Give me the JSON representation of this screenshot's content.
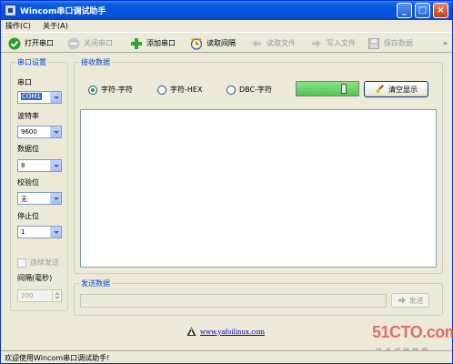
{
  "window": {
    "title": "Wincom串口调试助手",
    "minimize": "_",
    "maximize": "□",
    "close": "×"
  },
  "menu": [
    {
      "label": "操作(C)"
    },
    {
      "label": "关于(A)"
    }
  ],
  "toolbar": [
    {
      "label": "打开串口",
      "enabled": true
    },
    {
      "label": "关闭串口",
      "enabled": false
    },
    {
      "label": "添加串口",
      "enabled": true
    },
    {
      "label": "读取间隔",
      "enabled": true
    },
    {
      "label": "读取文件",
      "enabled": false
    },
    {
      "label": "写入文件",
      "enabled": false
    },
    {
      "label": "保存数据",
      "enabled": false
    }
  ],
  "serial_settings": {
    "title": "串口设置",
    "port": {
      "label": "串口",
      "value": "COM1"
    },
    "baud": {
      "label": "波特率",
      "value": "9600"
    },
    "data_bits": {
      "label": "数据位",
      "value": "8"
    },
    "parity": {
      "label": "校验位",
      "value": "无"
    },
    "stop_bits": {
      "label": "停止位",
      "value": "1"
    },
    "continuous": {
      "label": "连续发送",
      "checked": false
    },
    "interval": {
      "label": "间隔(毫秒)",
      "value": "200"
    }
  },
  "receive": {
    "title": "接收数据",
    "modes": [
      {
        "label": "字符-字符",
        "checked": true
      },
      {
        "label": "字符-HEX",
        "checked": false
      },
      {
        "label": "DBC-字符",
        "checked": false
      }
    ],
    "clear_label": "清空显示",
    "content": ""
  },
  "send": {
    "title": "发送数据",
    "button_label": "发送",
    "content": ""
  },
  "link": {
    "text": "www.yafoilinux.com"
  },
  "watermark": {
    "logo": "51CTO.com",
    "tagline": "技术成就梦想"
  },
  "status": {
    "text": "欢迎使用Wincom串口调试助手!"
  }
}
